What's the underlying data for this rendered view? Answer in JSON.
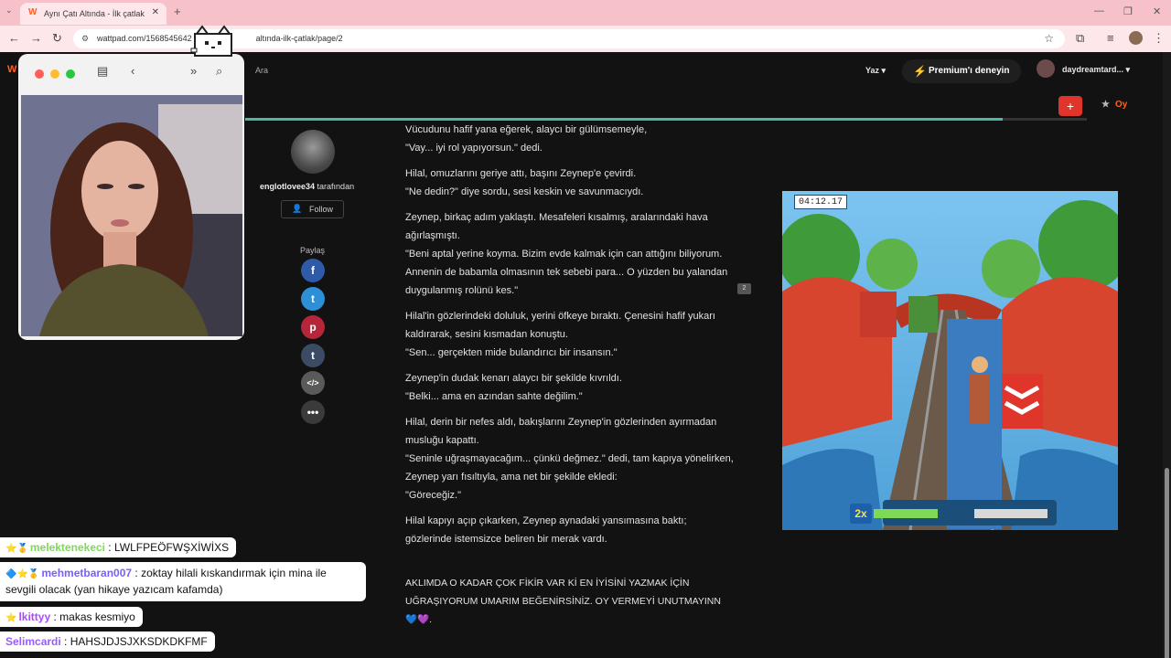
{
  "browser": {
    "tab_title": "Aynı Çatı Altında - İlk çatlak",
    "tab_close_icon": "close-icon",
    "new_tab_icon": "plus-icon",
    "url": "wattpad.com/1568545642-aynı-çatı-altında-ilk-çatlak/page/2",
    "url_display_start": "wattpad.com/1568545642",
    "url_display_end": "altında-ilk-çatlak/page/2"
  },
  "header": {
    "logo": "W",
    "search_label": "Ara",
    "write_label": "Yaz",
    "premium_label": "Premium'ı deneyin",
    "username": "daydreamtard...",
    "vote_label": "Oy",
    "add_label": "+",
    "reading_progress": 0.9
  },
  "author": {
    "name": "englotlovee34",
    "by_label": "tarafından",
    "follow_label": "Follow",
    "share_label": "Paylaş",
    "share_buttons": [
      "facebook-icon",
      "twitter-icon",
      "pinterest-icon",
      "tumblr-icon",
      "embed-icon",
      "more-icon"
    ]
  },
  "story": {
    "paragraphs": [
      [
        "Vücudunu hafif yana eğerek, alaycı bir gülümsemeyle,",
        "\"Vay... iyi rol yapıyorsun.\" dedi."
      ],
      [
        "Hilal, omuzlarını geriye attı, başını Zeynep'e çevirdi.",
        "\"Ne dedin?\" diye sordu, sesi keskin ve savunmacıydı."
      ],
      [
        "Zeynep, birkaç adım yaklaştı. Mesafeleri kısalmış, aralarındaki hava ağırlaşmıştı.",
        "\"Beni aptal yerine koyma. Bizim evde kalmak için can attığını biliyorum. Annenin de babamla olmasının tek sebebi para... O yüzden bu yalandan duygulanmış rolünü kes.\""
      ],
      [
        "Hilal'in gözlerindeki doluluk, yerini öfkeye bıraktı. Çenesini hafif yukarı kaldırarak, sesini kısmadan konuştu.",
        "\"Sen... gerçekten mide bulandırıcı bir insansın.\""
      ],
      [
        "Zeynep'in dudak kenarı alaycı bir şekilde kıvrıldı.",
        "\"Belki... ama en azından sahte değilim.\""
      ],
      [
        "Hilal, derin bir nefes aldı, bakışlarını Zeynep'in gözlerinden ayırmadan musluğu kapattı.",
        "\"Seninle uğraşmayacağım... çünkü değmez.\" dedi, tam kapıya yönelirken, Zeynep yarı fısıltıyla, ama net bir şekilde ekledi:",
        "\"Göreceğiz.\""
      ],
      [
        "Hilal kapıyı açıp çıkarken, Zeynep aynadaki yansımasına baktı; gözlerinde istemsizce beliren bir merak vardı."
      ]
    ],
    "author_note": "AKLIMDA O KADAR ÇOK FİKİR VAR Kİ EN İYİSİNİ YAZMAK İÇİN UĞRAŞIYORUM UMARIM BEĞENİRSİNİZ. OY VERMEYİ UNUTMAYINN",
    "author_note_end": "💙💜.",
    "comment_count": "2"
  },
  "game": {
    "timer": "04:12.17",
    "multiplier": "2x"
  },
  "chat": [
    {
      "badges": "⭐🥇",
      "name": "melektenekeci",
      "name_color": "#7ed957",
      "message": "LWLFPEÖFWŞXİWİXS"
    },
    {
      "badges": "🔷⭐🥇",
      "name": "mehmetbaran007",
      "name_color": "#7b5cff",
      "message": "zoktay hilali kıskandırmak için mina ile sevgili olacak (yan hikaye yazıcam kafamda)"
    },
    {
      "badges": "⭐",
      "name": "lkittyy",
      "name_color": "#a94cff",
      "message": "makas kesmiyo"
    },
    {
      "badges": "",
      "name": "Selimcardi",
      "name_color": "#9a5cff",
      "message": "HAHSJDJSJXKSDKDKFMF"
    }
  ],
  "colors": {
    "wattpad_orange": "#ff6122",
    "tab_bar": "#f6c1c9",
    "premium_purple": "#c842ff",
    "progress": "#4db8a8",
    "add_red": "#e0352b"
  }
}
